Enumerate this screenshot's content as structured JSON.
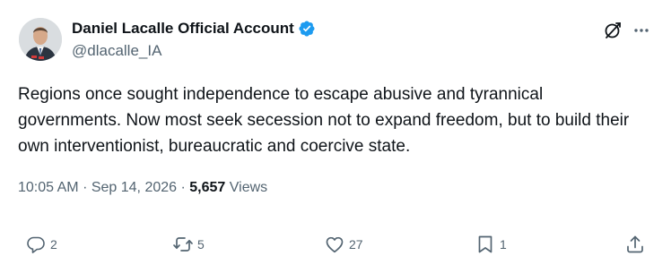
{
  "author": {
    "display_name": "Daniel Lacalle Official Account",
    "handle": "@dlacalle_IA",
    "verified": true
  },
  "tweet": {
    "text": "Regions once sought independence to escape abusive and tyrannical governments. Now most seek secession not to expand freedom, but to build their own interventionist, bureaucratic and coercive state.",
    "time": "10:05 AM",
    "separator": "·",
    "date": "Sep 14, 2026",
    "views_count": "5,657",
    "views_label": "Views"
  },
  "actions": {
    "reply_count": "2",
    "repost_count": "5",
    "like_count": "27",
    "bookmark_count": "1"
  },
  "icons": {
    "reply": "reply-icon",
    "repost": "repost-icon",
    "like": "like-icon",
    "bookmark": "bookmark-icon",
    "share": "share-icon",
    "grok": "grok-icon",
    "more": "more-icon",
    "verified": "verified-badge-icon"
  },
  "colors": {
    "text": "#0f1419",
    "secondary": "#536471",
    "verified": "#1d9bf0"
  }
}
